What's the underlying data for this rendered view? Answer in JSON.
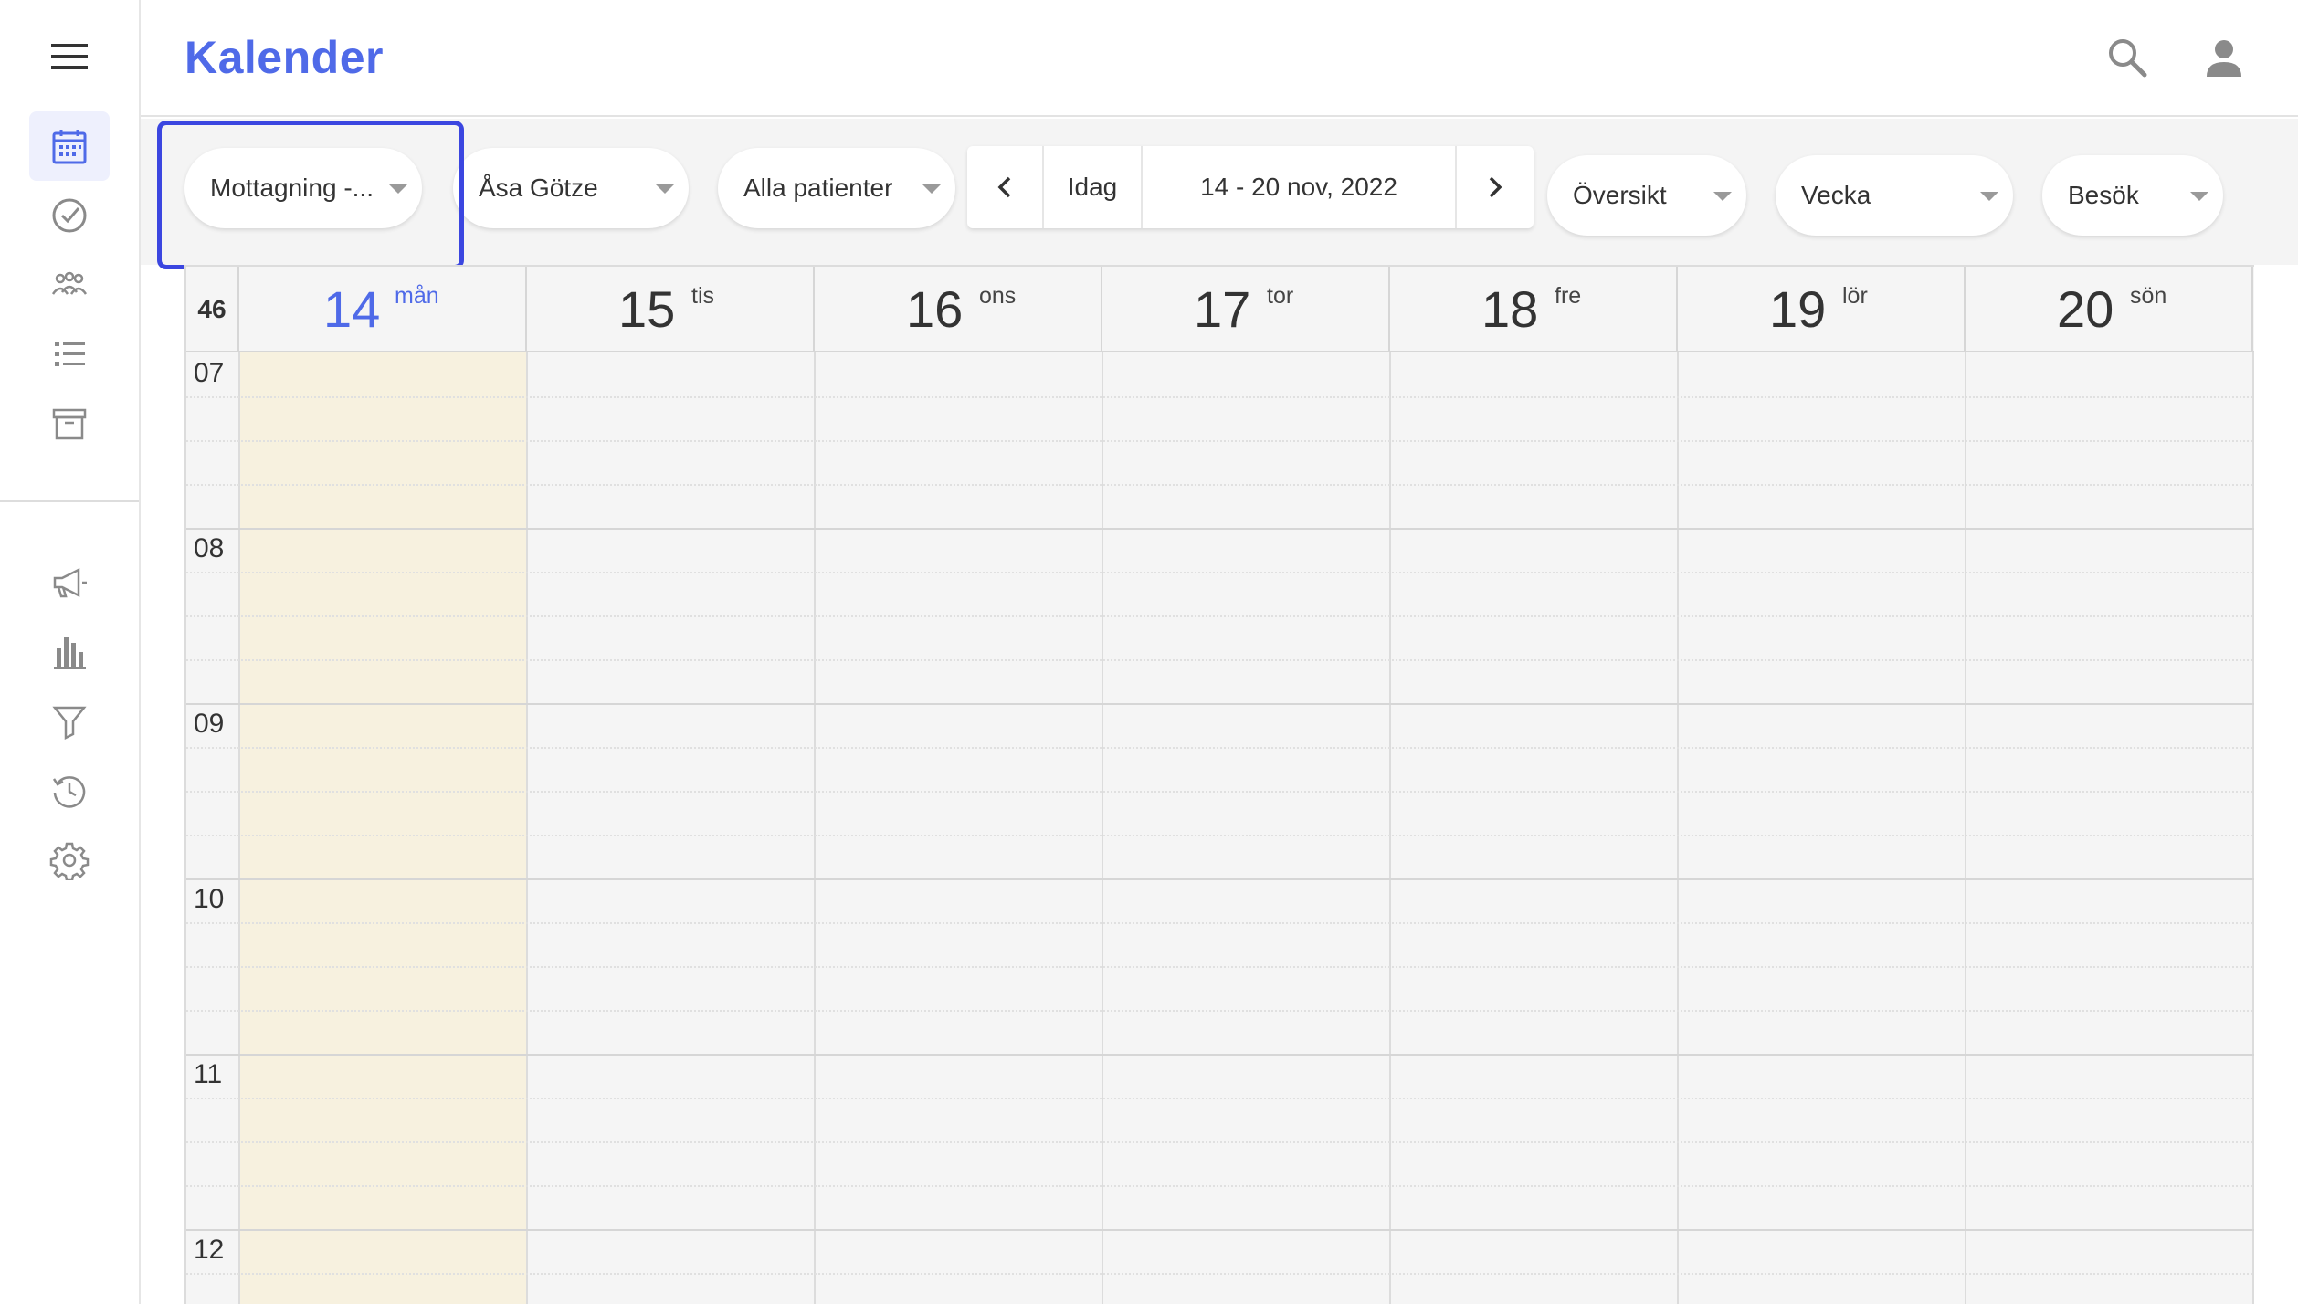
{
  "app": {
    "title": "Kalender"
  },
  "header": {
    "search_icon": "search-icon",
    "user_icon": "account-icon"
  },
  "sidebar": {
    "menu_icon": "hamburger-menu-icon",
    "items_top": [
      {
        "icon": "calendar-icon",
        "active": true
      },
      {
        "icon": "check-circle-icon",
        "active": false
      },
      {
        "icon": "people-group-icon",
        "active": false
      },
      {
        "icon": "list-icon",
        "active": false
      },
      {
        "icon": "archive-icon",
        "active": false
      }
    ],
    "items_bottom": [
      {
        "icon": "megaphone-icon"
      },
      {
        "icon": "bar-chart-icon"
      },
      {
        "icon": "filter-funnel-icon"
      },
      {
        "icon": "history-icon"
      },
      {
        "icon": "settings-gear-icon"
      }
    ]
  },
  "toolbar": {
    "clinic_select": "Mottagning -...",
    "staff_select": "Åsa Götze",
    "patient_select": "Alla patienter",
    "prev_label": "‹",
    "today_label": "Idag",
    "date_range": "14 - 20 nov, 2022",
    "next_label": "›",
    "view_select": "Översikt",
    "period_select": "Vecka",
    "type_select": "Besök"
  },
  "calendar": {
    "week_number": "46",
    "days": [
      {
        "num": "14",
        "name": "mån",
        "today": true
      },
      {
        "num": "15",
        "name": "tis",
        "today": false
      },
      {
        "num": "16",
        "name": "ons",
        "today": false
      },
      {
        "num": "17",
        "name": "tor",
        "today": false
      },
      {
        "num": "18",
        "name": "fre",
        "today": false
      },
      {
        "num": "19",
        "name": "lör",
        "today": false
      },
      {
        "num": "20",
        "name": "sön",
        "today": false
      }
    ],
    "hours": [
      "07",
      "08",
      "09",
      "10",
      "11",
      "12"
    ]
  },
  "colors": {
    "accent": "#4f6ae8",
    "today_column": "#f7f1df",
    "highlight_border": "#3b46e0"
  }
}
